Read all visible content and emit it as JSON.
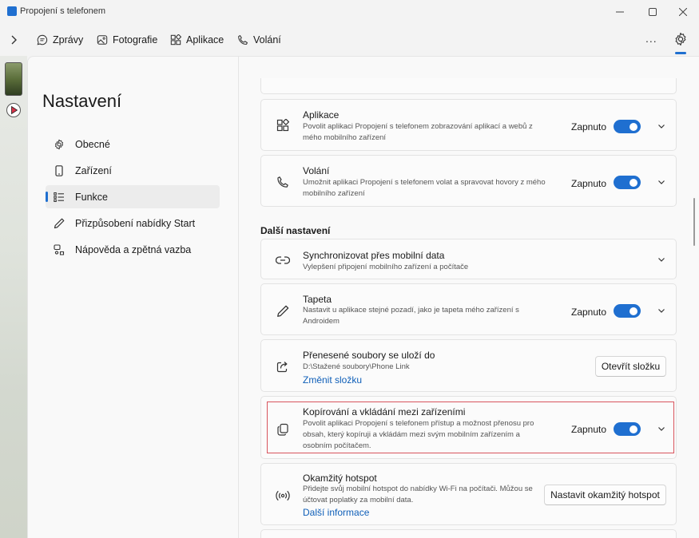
{
  "window": {
    "title": "Propojení s telefonem",
    "controls": [
      "minimize-icon",
      "maximize-icon",
      "close-icon"
    ]
  },
  "nav": {
    "tabs": [
      {
        "label": "Zprávy",
        "icon": "message-icon"
      },
      {
        "label": "Fotografie",
        "icon": "photo-icon"
      },
      {
        "label": "Aplikace",
        "icon": "apps-icon"
      },
      {
        "label": "Volání",
        "icon": "phone-icon"
      }
    ],
    "more": "...",
    "settings_icon": "gear-icon",
    "accent": "#1f6fd0"
  },
  "sidebar": {
    "title": "Nastavení",
    "items": [
      {
        "label": "Obecné",
        "icon": "gear-icon"
      },
      {
        "label": "Zařízení",
        "icon": "phone-device-icon"
      },
      {
        "label": "Funkce",
        "icon": "list-icon",
        "active": true
      },
      {
        "label": "Přizpůsobení nabídky Start",
        "icon": "pen-icon"
      },
      {
        "label": "Nápověda a zpětná vazba",
        "icon": "help-icon"
      }
    ]
  },
  "content": {
    "cards_top": [
      {
        "title": "Aplikace",
        "desc": "Povolit aplikaci Propojení s telefonem zobrazování aplikací a webů z mého mobilního zařízení",
        "status": "Zapnuto",
        "icon": "apps-icon"
      },
      {
        "title": "Volání",
        "desc": "Umožnit aplikaci Propojení s telefonem volat a spravovat hovory z mého mobilního zařízení",
        "status": "Zapnuto",
        "icon": "phone-icon"
      }
    ],
    "section_title": "Další nastavení",
    "sync": {
      "title": "Synchronizovat přes mobilní data",
      "desc": "Vylepšení připojení mobilního zařízení a počítače",
      "icon": "link-icon"
    },
    "wallpaper": {
      "title": "Tapeta",
      "desc": "Nastavit u aplikace stejné pozadí, jako je tapeta mého zařízení s Androidem",
      "status": "Zapnuto",
      "icon": "pen-icon"
    },
    "files": {
      "title": "Přenesené soubory se uloží do",
      "path": "D:\\Stažené soubory\\Phone Link",
      "link": "Změnit složku",
      "button": "Otevřít složku",
      "icon": "share-icon"
    },
    "copy": {
      "title": "Kopírování a vkládání mezi zařízeními",
      "desc": "Povolit aplikaci Propojení s telefonem přístup a možnost přenosu pro obsah, který kopíruji a vkládám mezi svým mobilním zařízením a osobním počítačem.",
      "status": "Zapnuto",
      "icon": "copy-icon"
    },
    "hotspot": {
      "title": "Okamžitý hotspot",
      "desc": "Přidejte svůj mobilní hotspot do nabídky Wi-Fi na počítači. Můžou se účtovat poplatky za mobilní data.",
      "link": "Další informace",
      "button": "Nastavit okamžitý hotspot",
      "icon": "hotspot-icon"
    }
  }
}
